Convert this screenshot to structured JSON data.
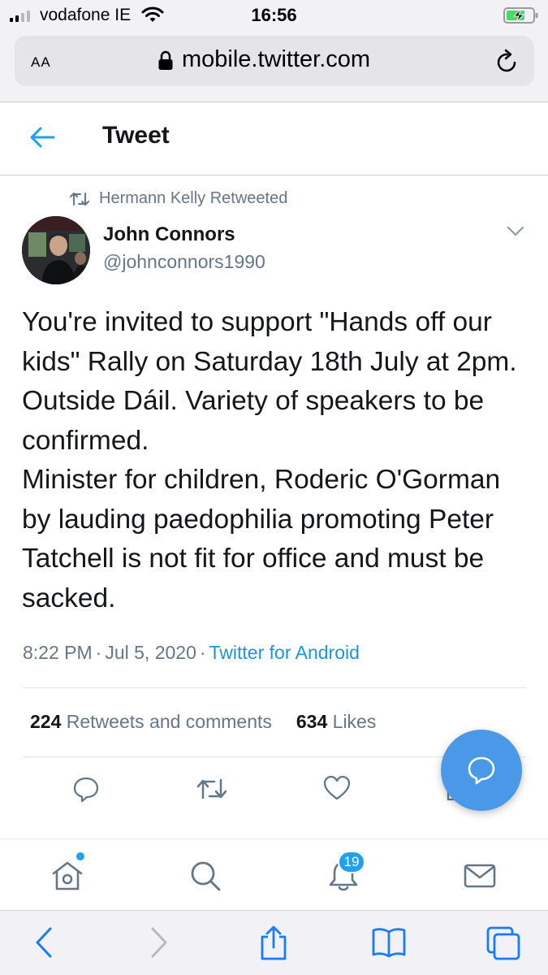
{
  "status_bar": {
    "carrier": "vodafone IE",
    "time": "16:56"
  },
  "browser": {
    "text_size_label": "AA",
    "url": "mobile.twitter.com"
  },
  "header": {
    "title": "Tweet"
  },
  "tweet": {
    "retweeted_by": "Hermann Kelly Retweeted",
    "author_name": "John Connors",
    "author_handle": "@johnconnors1990",
    "text": "You're invited to support \"Hands off our kids\" Rally on Saturday 18th July at 2pm. Outside Dáil. Variety of speakers to be confirmed.\nMinister for children, Roderic O'Gorman by lauding paedophilia promoting Peter Tatchell is not fit for office and must be sacked.",
    "time": "8:22 PM",
    "date": "Jul 5, 2020",
    "meta_separator": "·",
    "source": "Twitter for Android",
    "retweets_count": "224",
    "retweets_label": "Retweets and comments",
    "likes_count": "634",
    "likes_label": "Likes"
  },
  "bottom_nav": {
    "notifications_badge": "19"
  },
  "colors": {
    "accent": "#1da1f2",
    "fab": "#4a99e9",
    "secondary_text": "#657786",
    "primary_text": "#14171a",
    "icon_grey": "#657786"
  },
  "icons": {
    "status": [
      "signal-bars-icon",
      "wifi-icon",
      "battery-charging-icon"
    ],
    "browser": [
      "lock-icon",
      "reload-icon"
    ],
    "header": [
      "back-arrow-icon"
    ],
    "tweet": [
      "retweet-icon",
      "chevron-down-icon"
    ],
    "actions": [
      "reply-icon",
      "retweet-action-icon",
      "like-icon",
      "share-icon",
      "compose-message-icon"
    ],
    "bottom_nav": [
      "home-icon",
      "search-icon",
      "notifications-bell-icon",
      "messages-envelope-icon"
    ],
    "safari_toolbar": [
      "back-icon",
      "forward-icon",
      "share-icon",
      "bookmarks-icon",
      "tabs-icon"
    ]
  }
}
